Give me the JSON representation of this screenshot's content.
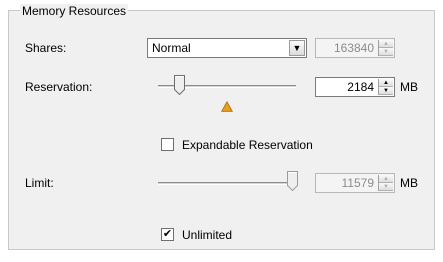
{
  "group": {
    "title": "Memory Resources"
  },
  "shares": {
    "label": "Shares:",
    "selected": "Normal",
    "value": "163840"
  },
  "reservation": {
    "label": "Reservation:",
    "value": "2184",
    "unit": "MB",
    "slider_level": 0.15
  },
  "expandable": {
    "label": "Expandable Reservation",
    "checked": false
  },
  "limit": {
    "label": "Limit:",
    "value": "11579",
    "unit": "MB",
    "slider_level": 1.0
  },
  "unlimited": {
    "label": "Unlimited",
    "checked": true
  },
  "colors": {
    "warning": "#e8a01c",
    "background": "#f0f0f0",
    "border": "#c8c8c8"
  },
  "icons": {
    "warning": "warning-triangle-icon"
  }
}
